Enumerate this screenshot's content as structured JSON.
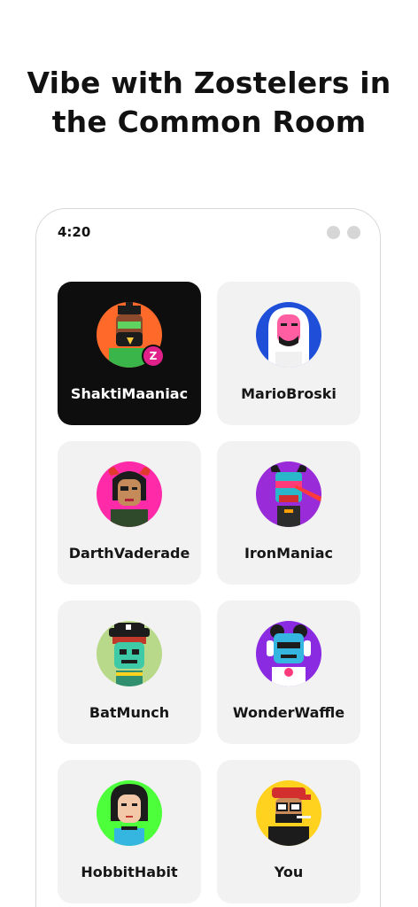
{
  "headline": {
    "line1": "Vibe with Zostelers in",
    "line2": "the Common Room"
  },
  "status_bar": {
    "time": "4:20"
  },
  "badge_letter": "Z",
  "members": [
    {
      "name": "ShaktiMaaniac",
      "avatar_bg": "#ff6a2b",
      "selected": true,
      "avatar_icon": "bearded-man-avatar-icon"
    },
    {
      "name": "MarioBroski",
      "avatar_bg": "#1f4fd8",
      "selected": false,
      "avatar_icon": "hooded-pink-face-avatar-icon"
    },
    {
      "name": "DarthVaderade",
      "avatar_bg": "#ff2aa8",
      "selected": false,
      "avatar_icon": "horned-woman-avatar-icon"
    },
    {
      "name": "IronManiac",
      "avatar_bg": "#9a2bd8",
      "selected": false,
      "avatar_icon": "laser-eyes-avatar-icon"
    },
    {
      "name": "BatMunch",
      "avatar_bg": "#b9d98a",
      "selected": false,
      "avatar_icon": "pirate-zombie-avatar-icon"
    },
    {
      "name": "WonderWaffle",
      "avatar_bg": "#8a2be2",
      "selected": false,
      "avatar_icon": "headphones-robot-avatar-icon"
    },
    {
      "name": "HobbitHabit",
      "avatar_bg": "#4cff3a",
      "selected": false,
      "avatar_icon": "black-hair-woman-avatar-icon"
    },
    {
      "name": "You",
      "avatar_bg": "#ffd21f",
      "selected": false,
      "avatar_icon": "red-cap-glasses-avatar-icon"
    }
  ]
}
